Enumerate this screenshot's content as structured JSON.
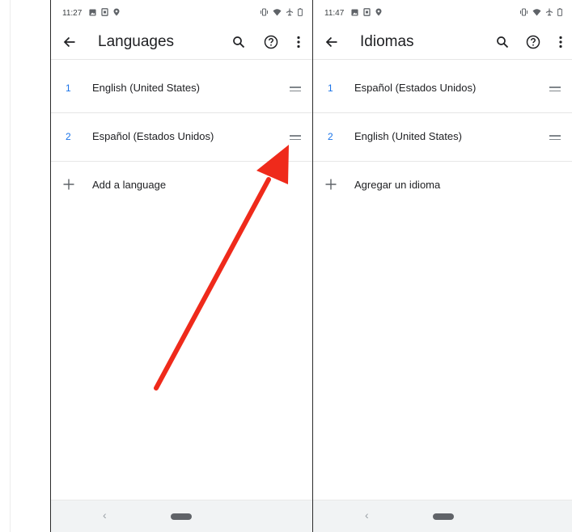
{
  "colors": {
    "accent_blue": "#1a73e8",
    "arrow_red": "#ef2a1b",
    "icon_gray": "#5f6368",
    "handle_gray": "#80868b",
    "nav_background": "#f1f3f4"
  },
  "phones": {
    "left": {
      "status": {
        "time": "11:27",
        "left_icons": [
          "image-icon",
          "sim-card-icon",
          "location-pin-icon"
        ],
        "right_icons": [
          "vibrate-icon",
          "wifi-icon",
          "airplane-icon",
          "battery-icon"
        ]
      },
      "app_bar": {
        "title": "Languages",
        "actions": [
          "search-icon",
          "help-icon",
          "more-vert-icon"
        ]
      },
      "languages": [
        {
          "number": "1",
          "name": "English (United States)"
        },
        {
          "number": "2",
          "name": "Español (Estados Unidos)"
        }
      ],
      "add_language": "Add a language",
      "nav": {
        "back_glyph": "‹"
      }
    },
    "right": {
      "status": {
        "time": "11:47",
        "left_icons": [
          "image-icon",
          "sim-card-icon",
          "location-pin-icon"
        ],
        "right_icons": [
          "vibrate-icon",
          "wifi-icon",
          "airplane-icon",
          "battery-icon"
        ]
      },
      "app_bar": {
        "title": "Idiomas",
        "actions": [
          "search-icon",
          "help-icon",
          "more-vert-icon"
        ]
      },
      "languages": [
        {
          "number": "1",
          "name": "Español (Estados Unidos)"
        },
        {
          "number": "2",
          "name": "English (United States)"
        }
      ],
      "add_language": "Agregar un idioma",
      "nav": {
        "back_glyph": "‹"
      }
    }
  }
}
